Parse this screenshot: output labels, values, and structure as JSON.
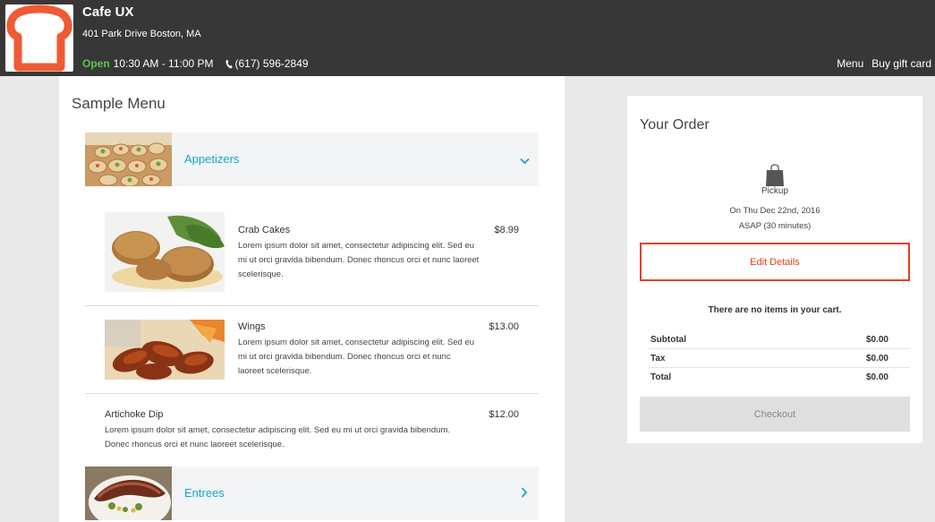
{
  "header": {
    "shop_name": "Cafe UX",
    "address": "401 Park Drive Boston, MA",
    "open_label": "Open",
    "hours": "10:30 AM - 11:00 PM",
    "phone": "(617) 596-2849",
    "nav": [
      {
        "label": "Menu"
      },
      {
        "label": "Buy gift card"
      }
    ]
  },
  "menu": {
    "title": "Sample Menu",
    "categories": [
      {
        "label": "Appetizers",
        "expanded": true
      },
      {
        "label": "Entrees",
        "expanded": false
      }
    ],
    "items": [
      {
        "name": "Crab Cakes",
        "price": "$8.99",
        "description": "Lorem ipsum dolor sit amet, consectetur adipiscing elit. Sed eu mi ut orci gravida bibendum. Donec rhoncus orci et nunc laoreet scelerisque."
      },
      {
        "name": "Wings",
        "price": "$13.00",
        "description": "Lorem ipsum dolor sit amet, consectetur adipiscing elit. Sed eu mi ut orci gravida bibendum. Donec rhoncus orci et nunc laoreet scelerisque."
      },
      {
        "name": "Artichoke Dip",
        "price": "$12.00",
        "description": "Lorem ipsum dolor sit amet, consectetur adipiscing elit. Sed eu mi ut orci gravida bibendum. Donec rhoncus orci et nunc laoreet scelerisque."
      }
    ]
  },
  "order": {
    "title": "Your Order",
    "pickup_label": "Pickup",
    "pickup_date": "On Thu Dec 22nd, 2016",
    "pickup_time": "ASAP (30 minutes)",
    "edit_label": "Edit Details",
    "empty_message": "There are no items in your cart.",
    "totals": [
      {
        "label": "Subtotal",
        "value": "$0.00"
      },
      {
        "label": "Tax",
        "value": "$0.00"
      },
      {
        "label": "Total",
        "value": "$0.00"
      }
    ],
    "checkout_label": "Checkout"
  },
  "colors": {
    "header_bg": "#373737",
    "open_green": "#5ac84a",
    "accent_teal": "#1aa6c6",
    "edit_red": "#e0421e",
    "logo_orange": "#ef5a35"
  }
}
